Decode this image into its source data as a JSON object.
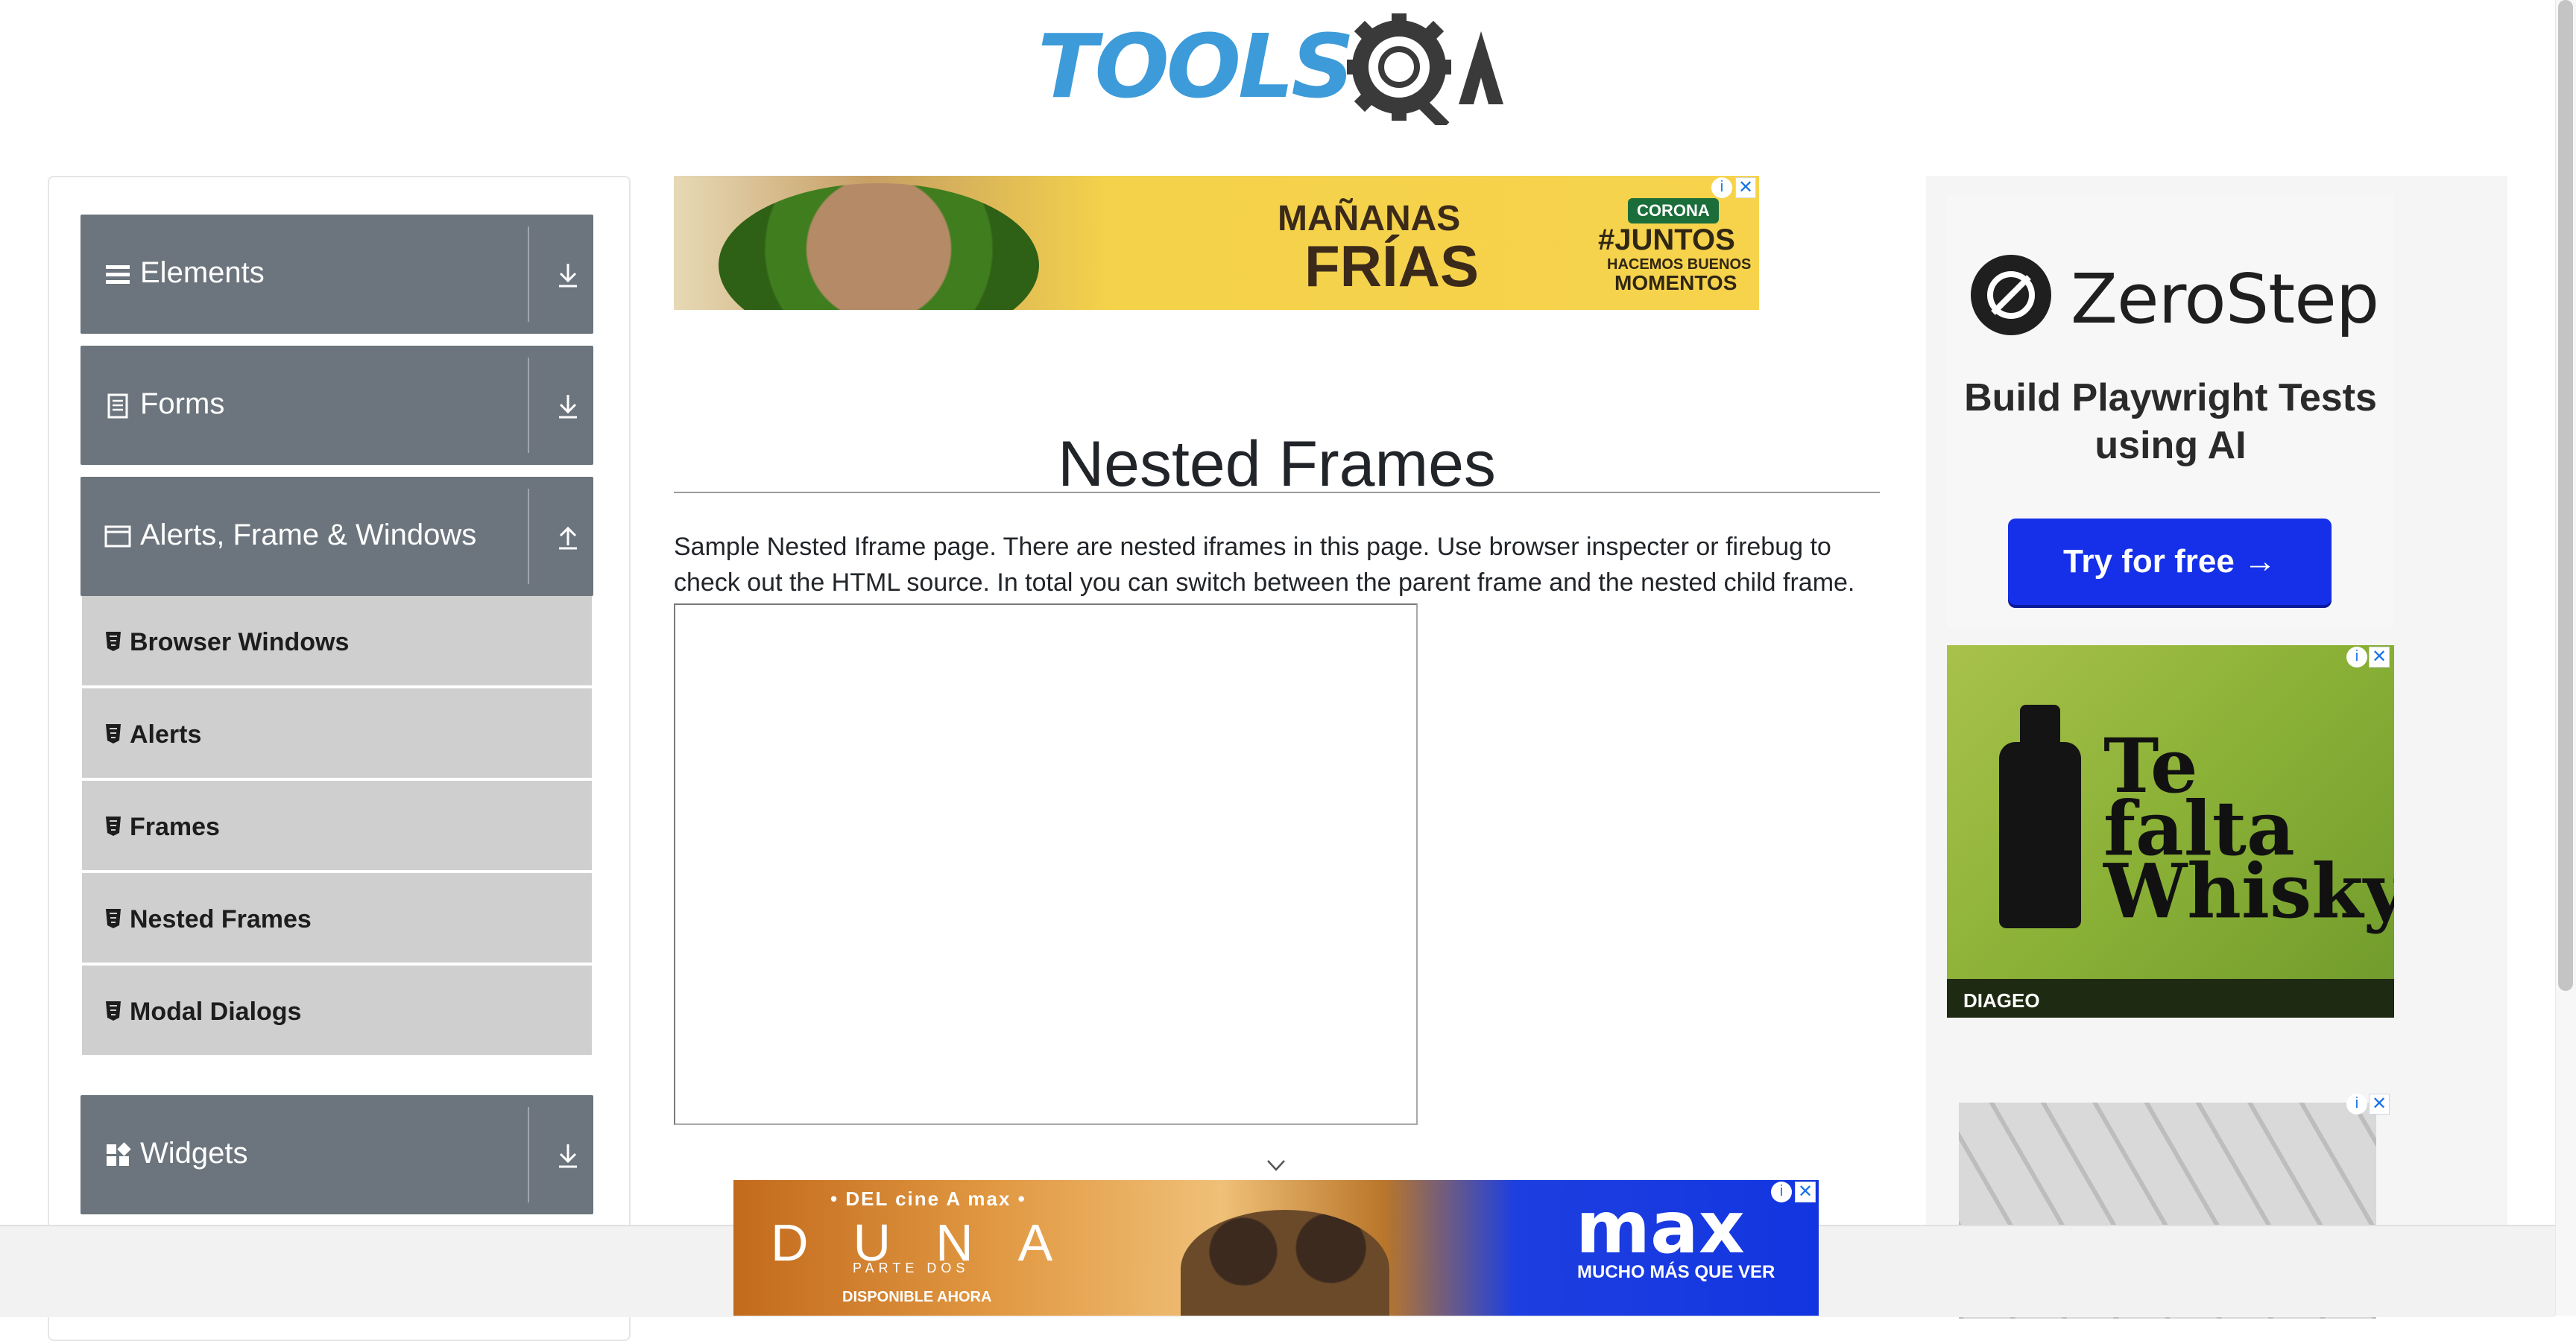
{
  "logo": {
    "text": "TOOLS",
    "brand": "TOOLSQA",
    "accent": "#3d9bd9"
  },
  "sidebar": {
    "groups": [
      {
        "label": "Elements",
        "icon": "hamburger-icon",
        "arrow": "download-icon"
      },
      {
        "label": "Forms",
        "icon": "document-icon",
        "arrow": "download-icon"
      },
      {
        "label": "Alerts, Frame & Windows",
        "icon": "window-icon",
        "arrow": "upload-icon"
      },
      {
        "label": "Widgets",
        "icon": "widgets-icon",
        "arrow": "download-icon"
      }
    ],
    "items": [
      {
        "label": "Browser Windows"
      },
      {
        "label": "Alerts"
      },
      {
        "label": "Frames"
      },
      {
        "label": "Nested Frames"
      },
      {
        "label": "Modal Dialogs"
      }
    ]
  },
  "ads": {
    "top": {
      "line1": "MAÑANAS",
      "line2": "FRÍAS",
      "badge": "CORONA",
      "line3": "#JUNTOS",
      "line4": "HACEMOS BUENOS",
      "line5": "MOMENTOS"
    },
    "zerostep": {
      "name": "ZeroStep",
      "desc": "Build Playwright Tests using AI",
      "cta": "Try for free →"
    },
    "whisky": {
      "text": "Te falta Whisky",
      "brand": "DIAGEO"
    },
    "bottom": {
      "topline": "• DEL cine A max •",
      "title": "DUNA",
      "subtitle": "PARTE DOS",
      "available": "DISPONIBLE AHORA",
      "brand": "max",
      "tagline": "MUCHO MÁS QUE VER"
    }
  },
  "main": {
    "title": "Nested Frames",
    "description": "Sample Nested Iframe page. There are nested iframes in this page. Use browser inspecter or firebug to check out the HTML source. In total you can switch between the parent frame and the nested child frame."
  }
}
